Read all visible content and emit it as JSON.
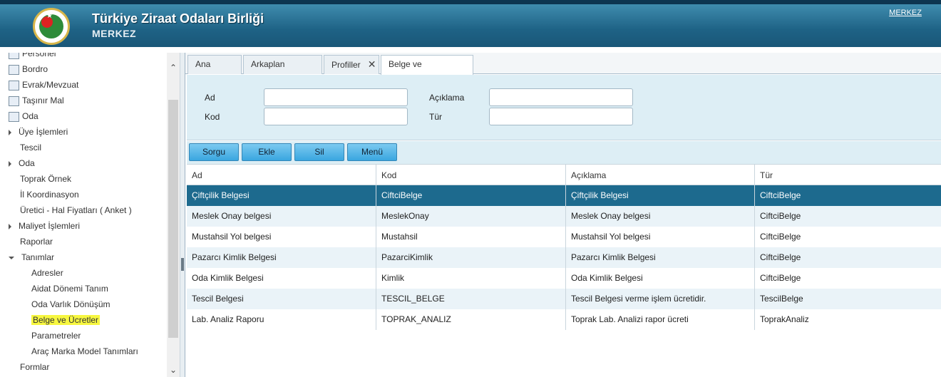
{
  "header": {
    "title": "Türkiye Ziraat Odaları Birliği",
    "subtitle": "MERKEZ",
    "user_link": "MERKEZ"
  },
  "sidebar": {
    "items": [
      {
        "label": "Personel",
        "icon": "personnel-icon",
        "type": "icon"
      },
      {
        "label": "Bordro",
        "icon": "payroll-icon",
        "type": "icon"
      },
      {
        "label": "Evrak/Mevzuat",
        "icon": "document-icon",
        "type": "icon"
      },
      {
        "label": "Taşınır Mal",
        "icon": "inventory-icon",
        "type": "icon"
      },
      {
        "label": "Oda",
        "icon": "chamber-icon",
        "type": "icon"
      },
      {
        "label": "Üye İşlemleri",
        "type": "collapsed"
      },
      {
        "label": "Tescil",
        "type": "leaf1"
      },
      {
        "label": "Oda",
        "type": "collapsed"
      },
      {
        "label": "Toprak Örnek",
        "type": "leaf1"
      },
      {
        "label": "İl Koordinasyon",
        "type": "leaf1"
      },
      {
        "label": "Üretici - Hal Fiyatları ( Anket )",
        "type": "leaf1"
      },
      {
        "label": "Maliyet İşlemleri",
        "type": "collapsed"
      },
      {
        "label": "Raporlar",
        "type": "leaf1"
      },
      {
        "label": "Tanımlar",
        "type": "expanded"
      },
      {
        "label": "Adresler",
        "type": "leaf2"
      },
      {
        "label": "Aidat Dönemi Tanım",
        "type": "leaf2"
      },
      {
        "label": "Oda Varlık Dönüşüm",
        "type": "leaf2"
      },
      {
        "label": "Belge ve Ücretler",
        "type": "leaf2",
        "highlighted": true
      },
      {
        "label": "Parametreler",
        "type": "leaf2"
      },
      {
        "label": "Araç Marka Model Tanımları",
        "type": "leaf2"
      },
      {
        "label": "Formlar",
        "type": "leaf1"
      }
    ]
  },
  "tabs": [
    {
      "label": "Ana Sayfa",
      "closable": false
    },
    {
      "label": "Arkaplan İşler",
      "closable": true
    },
    {
      "label": "Profiller",
      "closable": true
    },
    {
      "label": "Belge ve Ücretler",
      "closable": true,
      "active": true
    }
  ],
  "form": {
    "ad_label": "Ad",
    "kod_label": "Kod",
    "aciklama_label": "Açıklama",
    "tur_label": "Tür",
    "ad_value": "",
    "kod_value": "",
    "aciklama_value": "",
    "tur_value": ""
  },
  "toolbar": {
    "sorgu": "Sorgu",
    "ekle": "Ekle",
    "sil": "Sil",
    "menu": "Menü"
  },
  "grid": {
    "columns": [
      "Ad",
      "Kod",
      "Açıklama",
      "Tür"
    ],
    "rows": [
      [
        "Çiftçilik Belgesi",
        "CiftciBelge",
        "Çiftçilik Belgesi",
        "CiftciBelge"
      ],
      [
        "Meslek Onay belgesi",
        "MeslekOnay",
        "Meslek Onay belgesi",
        "CiftciBelge"
      ],
      [
        "Mustahsil Yol belgesi",
        "Mustahsil",
        "Mustahsil Yol belgesi",
        "CiftciBelge"
      ],
      [
        "Pazarcı Kimlik Belgesi",
        "PazarciKimlik",
        "Pazarcı Kimlik Belgesi",
        "CiftciBelge"
      ],
      [
        "Oda Kimlik Belgesi",
        "Kimlik",
        "Oda Kimlik Belgesi",
        "CiftciBelge"
      ],
      [
        "Tescil Belgesi",
        "TESCIL_BELGE",
        "Tescil Belgesi verme işlem ücretidir.",
        "TescilBelge"
      ],
      [
        "Lab. Analiz Raporu",
        "TOPRAK_ANALIZ",
        "Toprak Lab. Analizi rapor ücreti",
        "ToprakAnaliz"
      ]
    ],
    "selected_row": 0
  }
}
